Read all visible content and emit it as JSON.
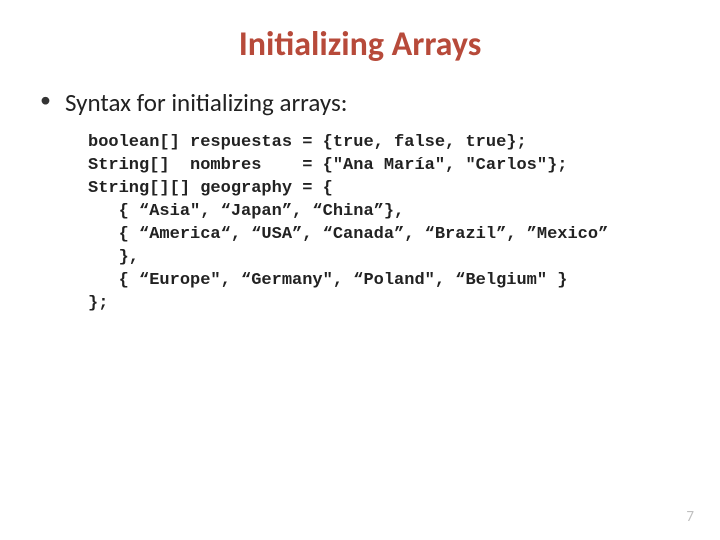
{
  "title": "Initializing Arrays",
  "bullet": "Syntax for initializing arrays:",
  "code": "boolean[] respuestas = {true, false, true};\nString[]  nombres    = {\"Ana María\", \"Carlos\"};\nString[][] geography = {\n   { “Asia\", “Japan”, “China”},\n   { “America“, “USA”, “Canada”, “Brazil”, ”Mexico”\n   },\n   { “Europe\", “Germany\", “Poland\", “Belgium\" }\n};",
  "page_number": "7"
}
